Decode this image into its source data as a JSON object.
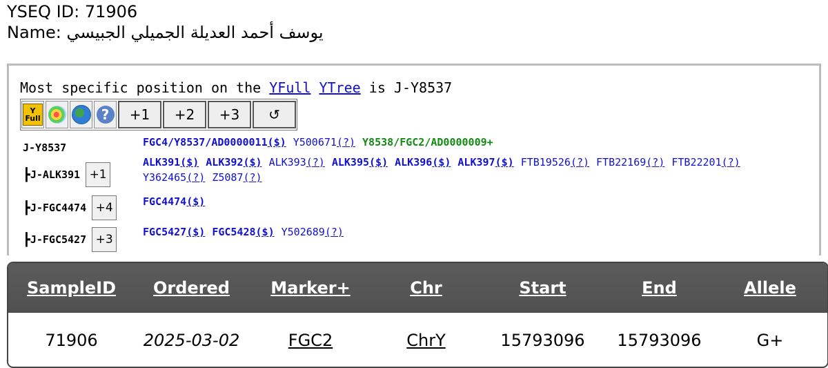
{
  "header": {
    "id_line": "YSEQ ID: 71906",
    "name_label": "Name:",
    "name_value": "يوسف أحمد العديلة الجميلي الجبيسي"
  },
  "tree": {
    "position_prefix": "Most specific position on the",
    "link_yfull": "YFull",
    "link_ytree": "YTree",
    "position_suffix": "is J-Y8537",
    "toolbar": {
      "icons": [
        "yfull-logo-icon",
        "heatmap-icon",
        "globe-icon",
        "help-icon"
      ],
      "yfull_icon_text_top": "Y",
      "yfull_icon_text_bottom": "Full",
      "help_glyph": "?",
      "buttons": [
        "+1",
        "+2",
        "+3",
        "↺"
      ]
    },
    "nodes": [
      {
        "name": "J-Y8537",
        "prefix": "",
        "count": "",
        "snps": [
          {
            "name": "FGC4/Y8537/AD0000011",
            "sym": "($)",
            "style": "bold"
          },
          {
            "name": "Y500671",
            "sym": "(?)",
            "style": "normal"
          },
          {
            "name": "Y8538/FGC2/AD0000009+",
            "sym": "",
            "style": "green"
          }
        ]
      },
      {
        "name": "J-ALK391",
        "prefix": "┣",
        "count": "+1",
        "snps": [
          {
            "name": "ALK391",
            "sym": "($)",
            "style": "bold"
          },
          {
            "name": "ALK392",
            "sym": "($)",
            "style": "bold"
          },
          {
            "name": "ALK393",
            "sym": "(?)",
            "style": "normal"
          },
          {
            "name": "ALK395",
            "sym": "($)",
            "style": "bold"
          },
          {
            "name": "ALK396",
            "sym": "($)",
            "style": "bold"
          },
          {
            "name": "ALK397",
            "sym": "($)",
            "style": "bold"
          },
          {
            "name": "FTB19526",
            "sym": "(?)",
            "style": "normal"
          },
          {
            "name": "FTB22169",
            "sym": "(?)",
            "style": "normal"
          },
          {
            "name": "FTB22201",
            "sym": "(?)",
            "style": "normal"
          },
          {
            "name": "Y362465",
            "sym": "(?)",
            "style": "normal"
          },
          {
            "name": "Z5087",
            "sym": "(?)",
            "style": "normal"
          }
        ]
      },
      {
        "name": "J-FGC4474",
        "prefix": "┣",
        "count": "+4",
        "snps": [
          {
            "name": "FGC4474",
            "sym": "($)",
            "style": "bold"
          }
        ]
      },
      {
        "name": "J-FGC5427",
        "prefix": "┣",
        "count": "+3",
        "snps": [
          {
            "name": "FGC5427",
            "sym": "($)",
            "style": "bold"
          },
          {
            "name": "FGC5428",
            "sym": "($)",
            "style": "bold"
          },
          {
            "name": "Y502689",
            "sym": "(?)",
            "style": "normal"
          }
        ]
      }
    ]
  },
  "results": {
    "headers": [
      "SampleID",
      "Ordered",
      "Marker+",
      "Chr",
      "Start",
      "End",
      "Allele"
    ],
    "row": {
      "sample_id": "71906",
      "ordered": "2025-03-02",
      "marker": "FGC2",
      "chr": "ChrY",
      "start": "15793096",
      "end": "15793096",
      "allele": "G+"
    }
  },
  "colors": {
    "link": "#1111cc",
    "positive_snp": "#138a13",
    "table_header_bg": "#555555",
    "box_border": "#bdbdbd"
  }
}
